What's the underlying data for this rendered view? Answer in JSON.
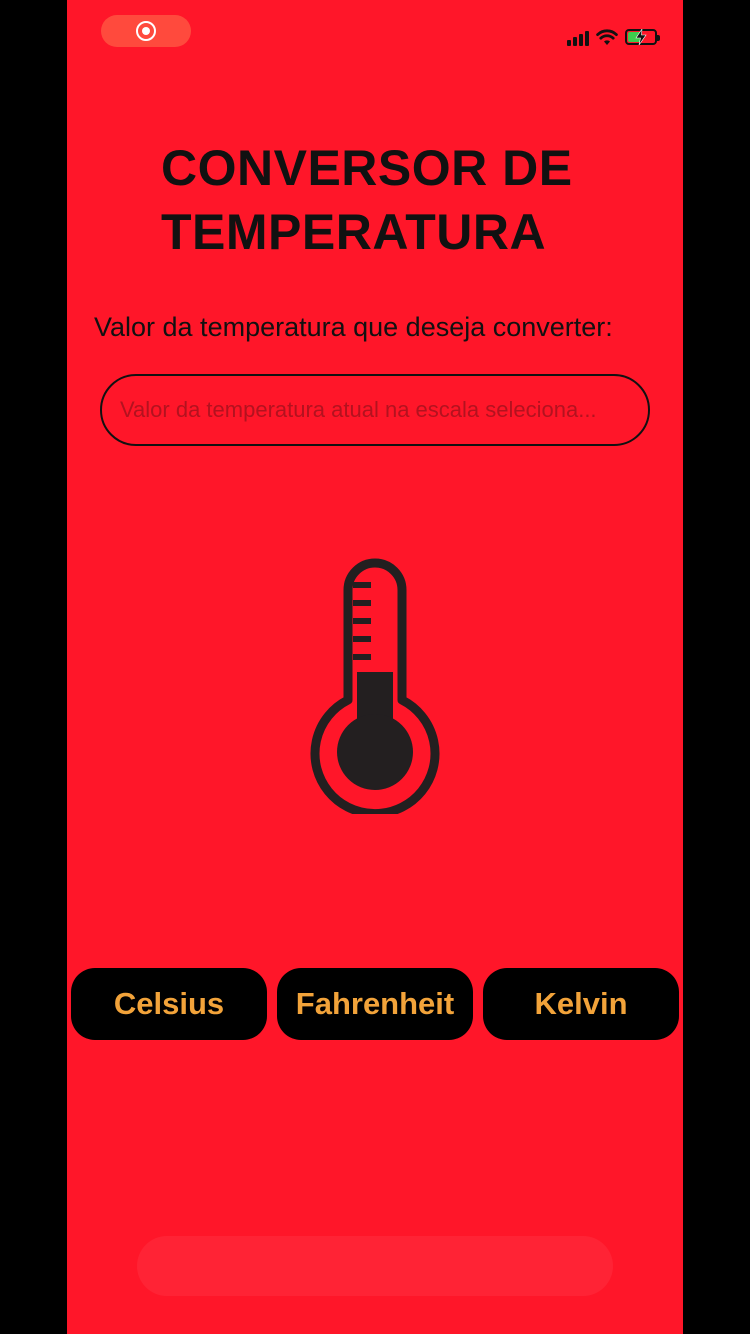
{
  "status_bar": {
    "recording_icon": "record-icon",
    "signal_icon": "cellular-signal-icon",
    "wifi_icon": "wifi-icon",
    "battery_icon": "battery-charging-icon"
  },
  "header": {
    "title": "CONVERSOR DE TEMPERATURA"
  },
  "form": {
    "prompt": "Valor da temperatura que deseja converter:",
    "input_value": "",
    "input_placeholder": "Valor da temperatura atual na escala seleciona..."
  },
  "illustration": {
    "icon": "thermometer-icon"
  },
  "scales": {
    "celsius": "Celsius",
    "fahrenheit": "Fahrenheit",
    "kelvin": "Kelvin"
  },
  "colors": {
    "background": "#ff1629",
    "button_background": "#000000",
    "button_text": "#f2a33a",
    "text": "#111111"
  }
}
